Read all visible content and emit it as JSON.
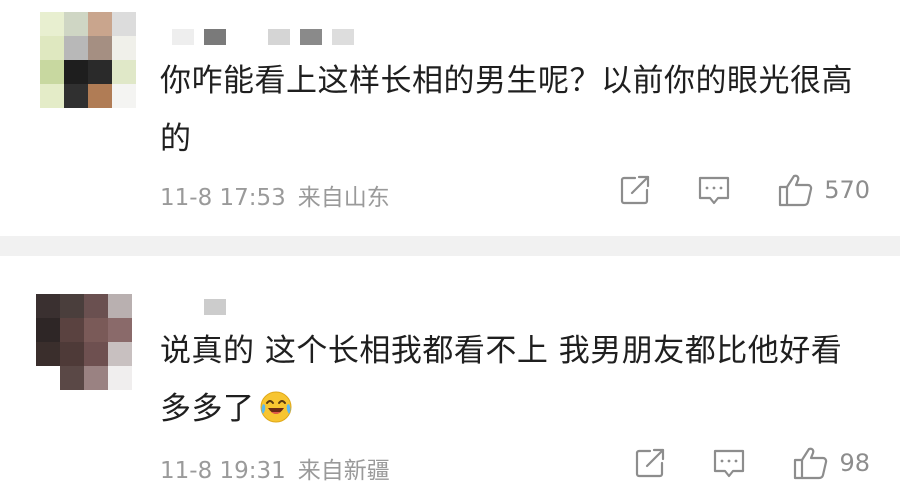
{
  "comments": [
    {
      "content": "你咋能看上这样长相的男生呢？以前你的眼光很高的",
      "time": "11-8 17:53",
      "location": "来自山东",
      "like_count": "570",
      "avatar_colors": [
        "#e8efd0",
        "#cfd6c4",
        "#c9a58d",
        "#dcdcdc",
        "#dfe8c0",
        "#b8b8b8",
        "#a58f82",
        "#f0f0ea",
        "#c8d8a0",
        "#1e1e1e",
        "#2a2a2a",
        "#e0e8c8",
        "#e4ecc8",
        "#303030",
        "#b07c55",
        "#f4f4f2"
      ],
      "username_colors": [
        "#eeeeee",
        "#7a7a7a",
        "#ffffff",
        "#d5d5d5",
        "#8a8a8a",
        "#dddddd"
      ]
    },
    {
      "content": "说真的 这个长相我都看不上 我男朋友都比他好看多多了",
      "time": "11-8 19:31",
      "location": "来自新疆",
      "like_count": "98",
      "avatar_colors": [
        "#3a3030",
        "#4a3e3c",
        "#6a5050",
        "#b9b0b0",
        "#2e2626",
        "#5a4240",
        "#7a5a58",
        "#8a6a6a",
        "#3a2e2c",
        "#4e3a38",
        "#6e5050",
        "#c8c0c0",
        "#ffffff",
        "#5a4846",
        "#9a8282",
        "#f0eeee"
      ],
      "username_colors": [
        "#ffffff",
        "#cccccc"
      ],
      "emoji": "laughing-crying-emoji"
    }
  ],
  "icons": {
    "share": "share-icon",
    "comment": "comment-icon",
    "like": "thumbs-up-icon"
  },
  "colors": {
    "text": "#1f1f1f",
    "meta": "#9a9a9a",
    "icon": "#8d8d8d",
    "divider": "#f1f1f1"
  }
}
